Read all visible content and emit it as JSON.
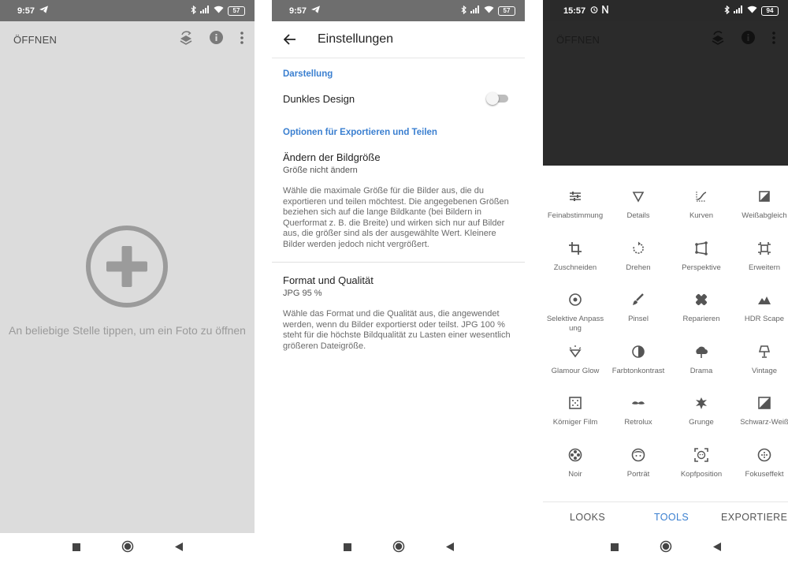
{
  "screen1": {
    "status": {
      "time": "9:57",
      "battery": "57"
    },
    "appbar": {
      "title": "ÖFFNEN"
    },
    "hint": "An beliebige Stelle tippen, um ein Foto zu öffnen"
  },
  "screen2": {
    "status": {
      "time": "9:57",
      "battery": "57"
    },
    "title": "Einstellungen",
    "section_display": "Darstellung",
    "dark_design": {
      "label": "Dunkles Design",
      "enabled": false
    },
    "section_export": "Optionen für Exportieren und Teilen",
    "resize": {
      "title": "Ändern der Bildgröße",
      "value": "Größe nicht ändern",
      "description": "Wähle die maximale Größe für die Bilder aus, die du exportieren und teilen möchtest. Die angegebenen Größen beziehen sich auf die lange Bildkante (bei Bildern in Querformat z. B. die Breite) und wirken sich nur auf Bilder aus, die größer sind als der ausgewählte Wert. Kleinere Bilder werden jedoch nicht vergrößert."
    },
    "format": {
      "title": "Format und Qualität",
      "value": "JPG 95 %",
      "description": "Wähle das Format und die Qualität aus, die angewendet werden, wenn du Bilder exportierst oder teilst. JPG 100 % steht für die höchste Bildqualität zu Lasten einer wesentlich größeren Dateigröße."
    }
  },
  "screen3": {
    "status": {
      "time": "15:57",
      "battery": "94"
    },
    "appbar": {
      "title": "ÖFFNEN"
    },
    "tools": [
      {
        "label": "Feinabstimmung",
        "icon": "tune-icon"
      },
      {
        "label": "Details",
        "icon": "details-icon"
      },
      {
        "label": "Kurven",
        "icon": "curves-icon"
      },
      {
        "label": "Weißabgleich",
        "icon": "white-balance-icon"
      },
      {
        "label": "Zuschneiden",
        "icon": "crop-icon"
      },
      {
        "label": "Drehen",
        "icon": "rotate-icon"
      },
      {
        "label": "Perspektive",
        "icon": "perspective-icon"
      },
      {
        "label": "Erweitern",
        "icon": "expand-icon"
      },
      {
        "label": "Selektive Anpassung",
        "icon": "selective-icon"
      },
      {
        "label": "Pinsel",
        "icon": "brush-icon"
      },
      {
        "label": "Reparieren",
        "icon": "healing-icon"
      },
      {
        "label": "HDR Scape",
        "icon": "hdr-icon"
      },
      {
        "label": "Glamour Glow",
        "icon": "glamour-glow-icon"
      },
      {
        "label": "Farbtonkontrast",
        "icon": "tonal-contrast-icon"
      },
      {
        "label": "Drama",
        "icon": "drama-icon"
      },
      {
        "label": "Vintage",
        "icon": "vintage-icon"
      },
      {
        "label": "Körniger Film",
        "icon": "grainy-film-icon"
      },
      {
        "label": "Retrolux",
        "icon": "retrolux-icon"
      },
      {
        "label": "Grunge",
        "icon": "grunge-icon"
      },
      {
        "label": "Schwarz-Weiß",
        "icon": "black-white-icon"
      },
      {
        "label": "Noir",
        "icon": "noir-icon"
      },
      {
        "label": "Porträt",
        "icon": "portrait-icon"
      },
      {
        "label": "Kopfposition",
        "icon": "head-pose-icon"
      },
      {
        "label": "Fokuseffekt",
        "icon": "lens-blur-icon"
      }
    ],
    "tabs": {
      "looks": "LOOKS",
      "tools": "TOOLS",
      "export": "EXPORTIEREN"
    },
    "colors": {
      "accent": "#3a7fd0"
    }
  }
}
